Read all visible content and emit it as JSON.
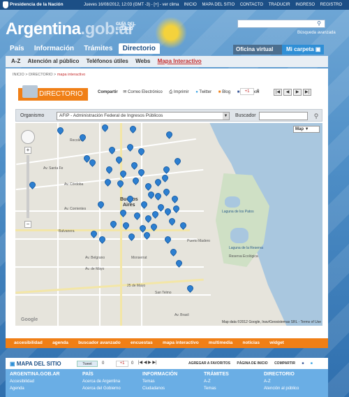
{
  "topbar": {
    "logo": "Presidencia de la Nación",
    "datetime": "Jueves 16/08/2012, 12:03 (GMT -3) - [+] - ver clima",
    "links": [
      "INICIO",
      "MAPA DEL SITIO",
      "CONTACTO",
      "TRADUCIR",
      "INGRESO",
      "REGISTRO"
    ]
  },
  "header": {
    "brand_main": "Argentina",
    "brand_suffix": ".gob.ar",
    "guia_line1": "GUÍA DEL",
    "guia_line2": "ESTADO",
    "search_placeholder": "",
    "search_icon": "search-icon",
    "advanced_search": "Búsqueda avanzada"
  },
  "nav": {
    "tabs": [
      {
        "label": "País"
      },
      {
        "label": "Información"
      },
      {
        "label": "Trámites"
      },
      {
        "label": "Directorio",
        "active": true
      }
    ],
    "oficina_virtual": "Oficina virtual",
    "mi_carpeta": "Mi carpeta"
  },
  "subnav": {
    "items": [
      "A-Z",
      "Atención al público",
      "Teléfonos útiles",
      "Webs",
      "Mapa Interactivo"
    ]
  },
  "breadcrumb": {
    "home": "INICIO",
    "section": "DIRECTORIO",
    "current": "mapa interactivo"
  },
  "directorio": {
    "title": "DIRECTORIO",
    "compartir": "Compartir",
    "share_items": [
      "Correo Electrónico",
      "Imprimir",
      "Twitter",
      "Blog",
      "Facebook"
    ],
    "gplus": "+1",
    "gplus_count": "0"
  },
  "filter": {
    "organismo_label": "Organismo",
    "organismo_value": "AFIP - Administración Federal de Ingresos Públicos",
    "buscador_label": "Buscador",
    "buscador_value": ""
  },
  "map": {
    "type_label": "Map",
    "labels": [
      "Recoleta",
      "Buenos",
      "Aires",
      "Reserva Ecológica",
      "Laguna de los Patos",
      "Laguna de la Reserva",
      "Puerto Madero",
      "Balvanera",
      "Monserrat",
      "San Telmo",
      "Av. Belgrano",
      "Av. Brasil",
      "25 de Mayo",
      "Av. Corrientes",
      "Av. Córdoba",
      "Av. de Mayo",
      "Av. Santa Fe"
    ],
    "copyright": "Map data ©2012 Google, Inav/Geosistemas SRL - Terms of Use",
    "google": "Google"
  },
  "footnav": {
    "items": [
      "accesibilidad",
      "agenda",
      "buscador avanzado",
      "encuestas",
      "mapa interactivo",
      "multimedia",
      "noticias",
      "widget"
    ]
  },
  "sitemap": {
    "title": "MAPA DEL SITIO",
    "tweet": "Tweet",
    "tweet_count": "0",
    "share_items": [
      "AGREGAR A FAVORITOS",
      "PÁGINA DE INICIO",
      "COMPARTIR"
    ],
    "columns": [
      {
        "heading": "ARGENTINA.GOB.AR",
        "items": [
          "Accesibilidad",
          "Agenda"
        ]
      },
      {
        "heading": "PAÍS",
        "items": [
          "Acerca de Argentina",
          "Acerca del Gobierno"
        ]
      },
      {
        "heading": "INFORMACIÓN",
        "items": [
          "Temas",
          "Ciudadanos"
        ]
      },
      {
        "heading": "TRÁMITES",
        "items": [
          "A-Z",
          "Temas"
        ]
      },
      {
        "heading": "DIRECTORIO",
        "items": [
          "A-Z",
          "Atención al público"
        ]
      }
    ]
  }
}
